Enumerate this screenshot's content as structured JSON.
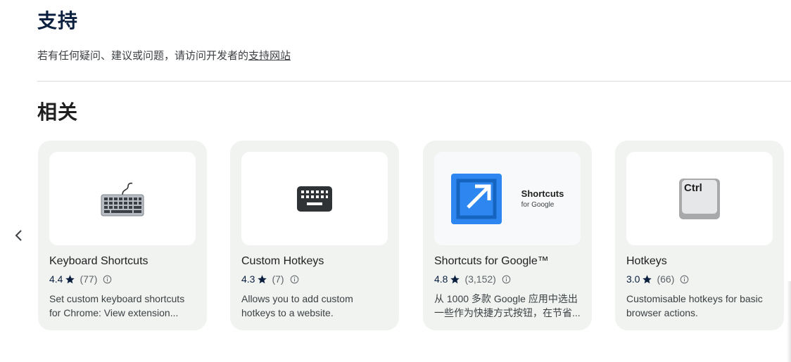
{
  "support": {
    "title": "支持",
    "text": "若有任何疑问、建议或问题，请访问开发者的",
    "link": "支持网站"
  },
  "related": {
    "title": "相关",
    "cards": [
      {
        "name": "Keyboard Shortcuts",
        "rating": "4.4",
        "count": "(77)",
        "description": "Set custom keyboard shortcuts for Chrome: View extension..."
      },
      {
        "name": "Custom Hotkeys",
        "rating": "4.3",
        "count": "(7)",
        "description": "Allows you to add custom hotkeys to a website."
      },
      {
        "name": "Shortcuts for Google™",
        "rating": "4.8",
        "count": "(3,152)",
        "description": "从 1000 多款 Google 应用中选出一些作为快捷方式按钮，在节省...",
        "logo_main": "Shortcuts",
        "logo_sub": "for Google"
      },
      {
        "name": "Hotkeys",
        "rating": "3.0",
        "count": "(66)",
        "description": "Customisable hotkeys for basic browser actions.",
        "logo_key": "Ctrl"
      }
    ]
  },
  "icons": {
    "prev": "chevron-left-icon",
    "star": "star-icon",
    "info": "info-icon"
  },
  "colors": {
    "title": "#0b1f3f",
    "card_bg": "#f1f3f1",
    "sg_blue": "#1a73e8"
  }
}
